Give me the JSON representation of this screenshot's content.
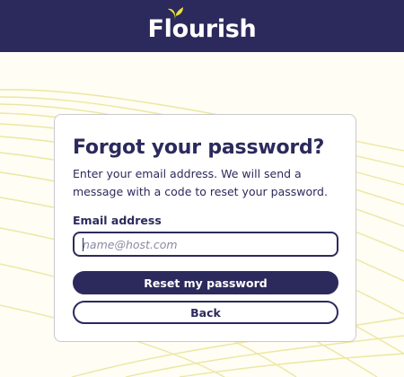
{
  "header": {
    "logo_text": "Flourish",
    "logo_icon": "leaf-sprout-icon",
    "background_color": "#2c2a5c"
  },
  "form": {
    "title": "Forgot your password?",
    "description": "Enter your email address. We will send a message with a code to reset your password.",
    "email_label": "Email address",
    "email_value": "",
    "email_placeholder": "name@host.com",
    "reset_button_label": "Reset my password",
    "back_button_label": "Back"
  },
  "colors": {
    "brand_navy": "#2c2a5c",
    "leaf_yellow": "#e8e13a",
    "background_lines": "#ece7a2"
  }
}
